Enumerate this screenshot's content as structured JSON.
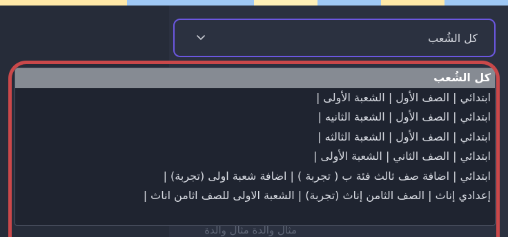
{
  "select": {
    "value": "كل الشُعب",
    "chevron_icon": "chevron-down-icon"
  },
  "dropdown": {
    "options": [
      "كل الشُعب",
      "ابتدائي | الصف الأول | الشعبة الأولى |",
      "ابتدائي | الصف الأول | الشعبة الثانيه |",
      "ابتدائي | الصف الأول | الشعبة الثالثه |",
      "ابتدائي | الصف الثاني | الشعبة الأولى |",
      "ابتدائي | اضافة صف ثالث فئة ب ( تجربة ) | اضافة شعبة اولى (تجربة) |",
      "إعدادي إناث | الصف الثامن إناث (تجربة) | الشعبة الاولى للصف اثامن اناث |"
    ],
    "selected_index": 0
  },
  "background": {
    "partial_text": "مثال والدة          مثال والدة"
  },
  "colors": {
    "page_bg": "#2b3140",
    "select_border": "#6b57e0",
    "option_selected_bg": "#868b93",
    "annotation_border": "#c9484a"
  }
}
